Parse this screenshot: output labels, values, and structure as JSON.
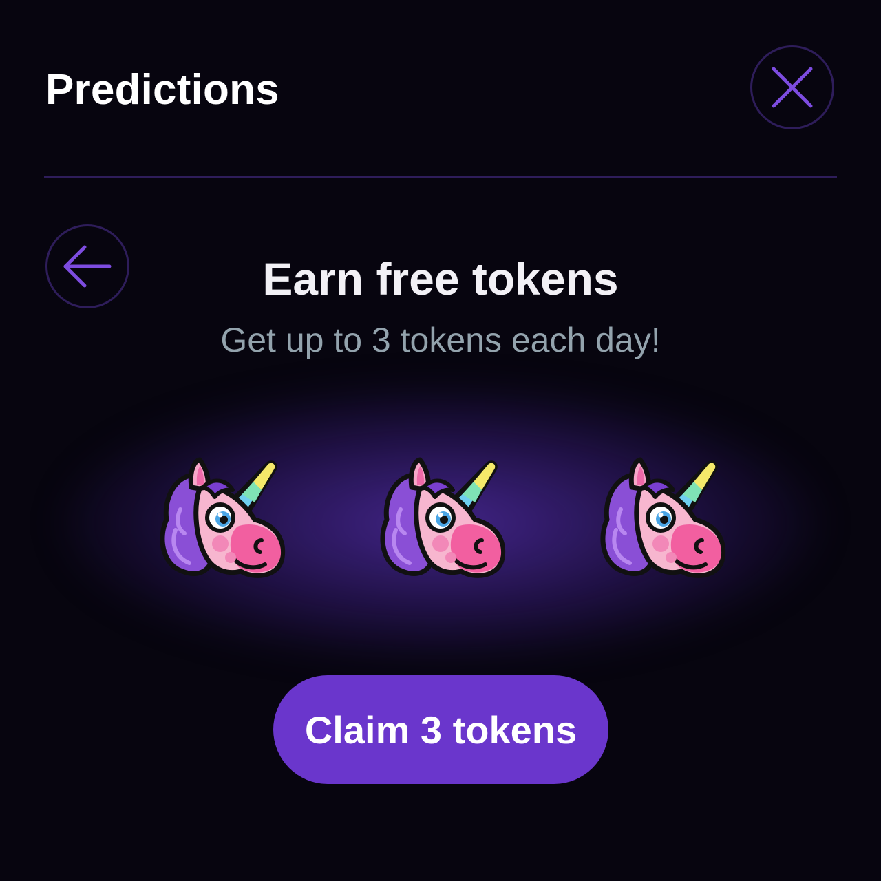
{
  "header": {
    "title": "Predictions",
    "close_icon": "close-icon"
  },
  "main": {
    "back_icon": "arrow-left-icon",
    "heading": "Earn free tokens",
    "subheading": "Get up to 3 tokens each day!",
    "tokens": [
      {
        "icon": "unicorn-icon"
      },
      {
        "icon": "unicorn-icon"
      },
      {
        "icon": "unicorn-icon"
      }
    ],
    "claim_button_label": "Claim 3 tokens"
  },
  "colors": {
    "background": "#07050f",
    "accent": "#6a36cc",
    "icon_stroke": "#7d4ce0",
    "ring": "#2e1d5a",
    "subtext": "#93a3ad"
  }
}
